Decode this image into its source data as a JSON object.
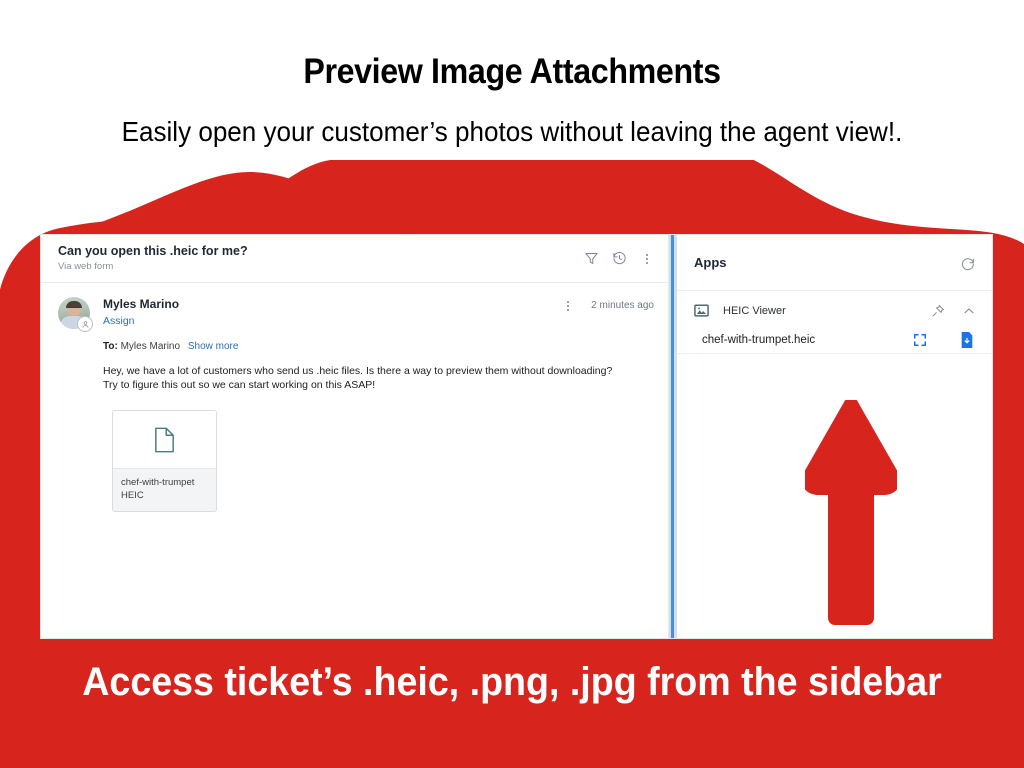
{
  "slide": {
    "title": "Preview Image Attachments",
    "subtitle": "Easily open your customer’s photos without leaving the agent view!.",
    "banner": "Access ticket’s .heic, .png, .jpg from the sidebar",
    "accent_red": "#D7251E",
    "banner_text_color": "#FFFFFF"
  },
  "ticket": {
    "subject": "Can you open this .heic for me?",
    "via": "Via web form",
    "header_icons": [
      {
        "name": "filter-icon",
        "label": "Filter"
      },
      {
        "name": "history-icon",
        "label": "History"
      },
      {
        "name": "more-options-icon",
        "label": "More"
      }
    ],
    "message": {
      "author": "Myles Marino",
      "assign_link": "Assign",
      "timestamp": "2 minutes ago",
      "to_label": "To:",
      "to_value": "Myles Marino",
      "show_more": "Show more",
      "body_line_1": "Hey, we have a lot of customers who send us .heic files. Is there a way to preview them without downloading?",
      "body_line_2": "Try to figure this out so we can start working on this ASAP!"
    },
    "attachment": {
      "filename": "chef-with-trumpet",
      "filetype": "HEIC",
      "icon": "document-icon",
      "icon_color": "#4A7C82"
    }
  },
  "apps_panel": {
    "title": "Apps",
    "refresh_icon": "refresh-icon",
    "app": {
      "name": "HEIC Viewer",
      "icon": "image-app-icon",
      "pin_icon": "pin-icon",
      "collapse_icon": "chevron-up-icon"
    },
    "file": {
      "name": "chef-with-trumpet.heic",
      "expand_icon": "fullscreen-icon",
      "download_icon": "download-file-icon",
      "action_color": "#1A73E8"
    }
  },
  "annotation": {
    "arrow": "up-arrow-annotation",
    "arrow_color": "#D7251E"
  },
  "splitter": {
    "name": "pane-splitter",
    "color": "#4A90D9"
  }
}
